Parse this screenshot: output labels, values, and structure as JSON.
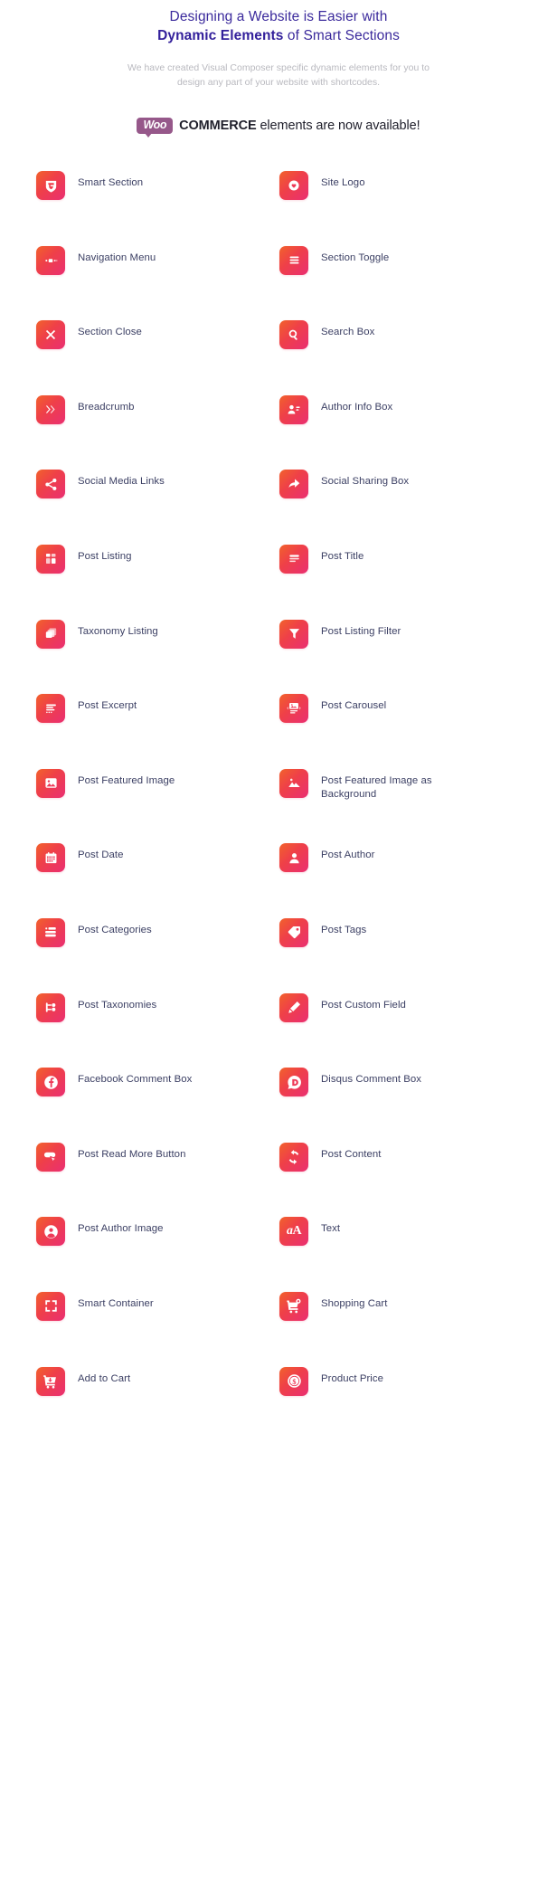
{
  "header": {
    "headline_line1": "Designing a Website is Easier with",
    "headline_strong": "Dynamic Elements",
    "headline_rest": " of Smart Sections",
    "subhead": "We have created Visual Composer specific dynamic elements for you to design any part of your website with shortcodes."
  },
  "woo_banner": {
    "badge": "Woo",
    "strong": "COMMERCE",
    "rest": " elements are now available!",
    "badge_color": "#96588a"
  },
  "theme": {
    "tile_gradient_start": "#f2622b",
    "tile_gradient_mid": "#ef4048",
    "tile_gradient_end": "#ea2f72",
    "label_color": "#3b3f63",
    "headline_color": "#3b2a9c",
    "subhead_color": "#b9b9bf"
  },
  "elements": [
    {
      "label": "Smart Section",
      "icon": "smart-section-shield-icon"
    },
    {
      "label": "Site Logo",
      "icon": "heart-circle-icon"
    },
    {
      "label": "Navigation Menu",
      "icon": "navigation-menu-icon"
    },
    {
      "label": "Section Toggle",
      "icon": "hamburger-lines-icon"
    },
    {
      "label": "Section Close",
      "icon": "close-x-icon"
    },
    {
      "label": "Search Box",
      "icon": "search-icon"
    },
    {
      "label": "Breadcrumb",
      "icon": "double-chevron-right-icon"
    },
    {
      "label": "Author Info Box",
      "icon": "author-info-icon"
    },
    {
      "label": "Social Media Links",
      "icon": "share-nodes-icon"
    },
    {
      "label": "Social Sharing Box",
      "icon": "share-arrow-icon"
    },
    {
      "label": "Post Listing",
      "icon": "grid-blocks-icon"
    },
    {
      "label": "Post Title",
      "icon": "text-lines-icon"
    },
    {
      "label": "Taxonomy Listing",
      "icon": "stacked-squares-icon"
    },
    {
      "label": "Post Listing Filter",
      "icon": "funnel-filter-icon"
    },
    {
      "label": "Post Excerpt",
      "icon": "excerpt-lines-icon"
    },
    {
      "label": "Post Carousel",
      "icon": "carousel-image-icon"
    },
    {
      "label": "Post Featured Image",
      "icon": "image-frame-icon"
    },
    {
      "label": "Post Featured Image as Background",
      "icon": "mountain-image-icon"
    },
    {
      "label": "Post Date",
      "icon": "calendar-icon"
    },
    {
      "label": "Post Author",
      "icon": "user-icon"
    },
    {
      "label": "Post Categories",
      "icon": "category-list-icon"
    },
    {
      "label": "Post Tags",
      "icon": "tag-icon"
    },
    {
      "label": "Post Taxonomies",
      "icon": "taxonomy-tree-icon"
    },
    {
      "label": "Post Custom Field",
      "icon": "pencil-icon"
    },
    {
      "label": "Facebook Comment Box",
      "icon": "facebook-icon"
    },
    {
      "label": "Disqus Comment Box",
      "icon": "disqus-icon"
    },
    {
      "label": "Post Read More Button",
      "icon": "cursor-button-icon"
    },
    {
      "label": "Post Content",
      "icon": "refresh-content-icon"
    },
    {
      "label": "Post Author Image",
      "icon": "user-circle-icon"
    },
    {
      "label": "Text",
      "icon": "text-aA-icon"
    },
    {
      "label": "Smart Container",
      "icon": "expand-corners-icon"
    },
    {
      "label": "Shopping Cart",
      "icon": "shopping-cart-badge-icon"
    },
    {
      "label": "Add to Cart",
      "icon": "add-to-cart-icon"
    },
    {
      "label": "Product Price",
      "icon": "dollar-coin-icon"
    }
  ]
}
